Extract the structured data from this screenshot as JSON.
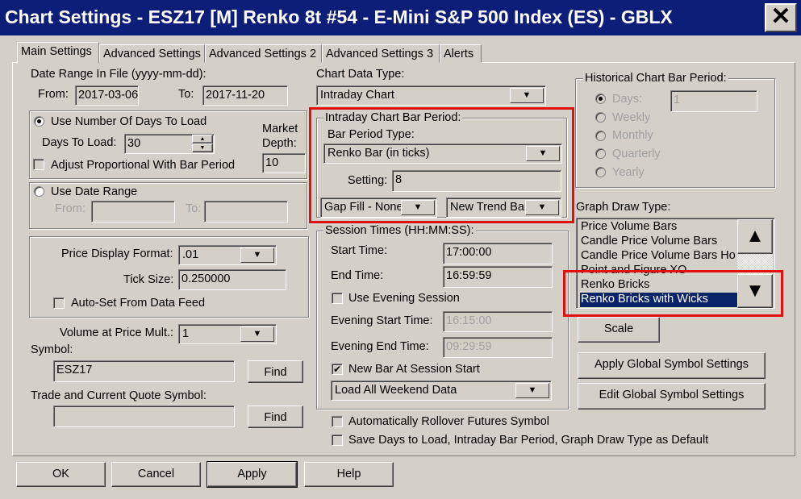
{
  "window": {
    "title": "Chart Settings - ESZ17 [M]  Renko 8t  #54 - E-Mini S&P 500 Index (ES) - GBLX",
    "close": "✕"
  },
  "tabs": [
    "Main Settings",
    "Advanced Settings",
    "Advanced Settings 2",
    "Advanced Settings 3",
    "Alerts"
  ],
  "date_range": {
    "label": "Date Range In File (yyyy-mm-dd):",
    "from_label": "From:",
    "from": "2017-03-06",
    "to_label": "To:",
    "to": "2017-11-20"
  },
  "days": {
    "radio_label": "Use Number Of Days To Load",
    "days_label": "Days To Load:",
    "days_value": "30",
    "market_depth_label1": "Market",
    "market_depth_label2": "Depth:",
    "market_depth": "10",
    "adjust_label": "Adjust Proportional With Bar Period"
  },
  "date_range_opt": {
    "radio_label": "Use Date Range",
    "from_label": "From:",
    "to_label": "To:"
  },
  "price": {
    "format_label": "Price Display Format:",
    "format": ".01",
    "tick_label": "Tick Size:",
    "tick": "0.250000",
    "autoset_label": "Auto-Set From Data Feed"
  },
  "volume": {
    "label": "Volume at Price Mult.:",
    "value": "1"
  },
  "symbol": {
    "label": "Symbol:",
    "value": "ESZ17",
    "find": "Find",
    "trade_label": "Trade and Current Quote Symbol:",
    "trade_value": "",
    "find2": "Find"
  },
  "chart_data_type": {
    "label": "Chart Data Type:",
    "value": "Intraday Chart"
  },
  "intraday": {
    "title": "Intraday Chart Bar Period:",
    "type_label": "Bar Period Type:",
    "type": "Renko Bar (in ticks)",
    "setting_label": "Setting:",
    "setting": "8",
    "gap_fill": "Gap Fill - None",
    "new_trend": "New Trend Bar"
  },
  "session": {
    "title": "Session Times (HH:MM:SS):",
    "start_label": "Start Time:",
    "start": "17:00:00",
    "end_label": "End Time:",
    "end": "16:59:59",
    "evening_label": "Use Evening Session",
    "eve_start_label": "Evening Start Time:",
    "eve_start": "16:15:00",
    "eve_end_label": "Evening End Time:",
    "eve_end": "09:29:59",
    "newbar_label": "New Bar At Session Start",
    "weekend": "Load All Weekend Data"
  },
  "rollover_label": "Automatically Rollover Futures Symbol",
  "save_default_label": "Save Days to Load, Intraday Bar Period, Graph Draw Type as Default",
  "historical": {
    "title": "Historical Chart Bar Period:",
    "days_label": "Days:",
    "days_value": "1",
    "options": [
      "Weekly",
      "Monthly",
      "Quarterly",
      "Yearly"
    ]
  },
  "graph_draw": {
    "label": "Graph Draw Type:",
    "items": [
      "Price Volume Bars",
      "Candle Price Volume Bars",
      "Candle Price Volume Bars Ho",
      "Point and Figure XO",
      "Renko Bricks",
      "Renko Bricks with Wicks"
    ],
    "selected": "Renko Bricks with Wicks"
  },
  "buttons": {
    "scale": "Scale",
    "apply_global": "Apply Global Symbol Settings",
    "edit_global": "Edit Global Symbol Settings",
    "ok": "OK",
    "cancel": "Cancel",
    "apply": "Apply",
    "help": "Help"
  },
  "colors": {
    "title_bar": "#0c1e78",
    "highlight": "#e01010",
    "selection": "#0a246a"
  }
}
